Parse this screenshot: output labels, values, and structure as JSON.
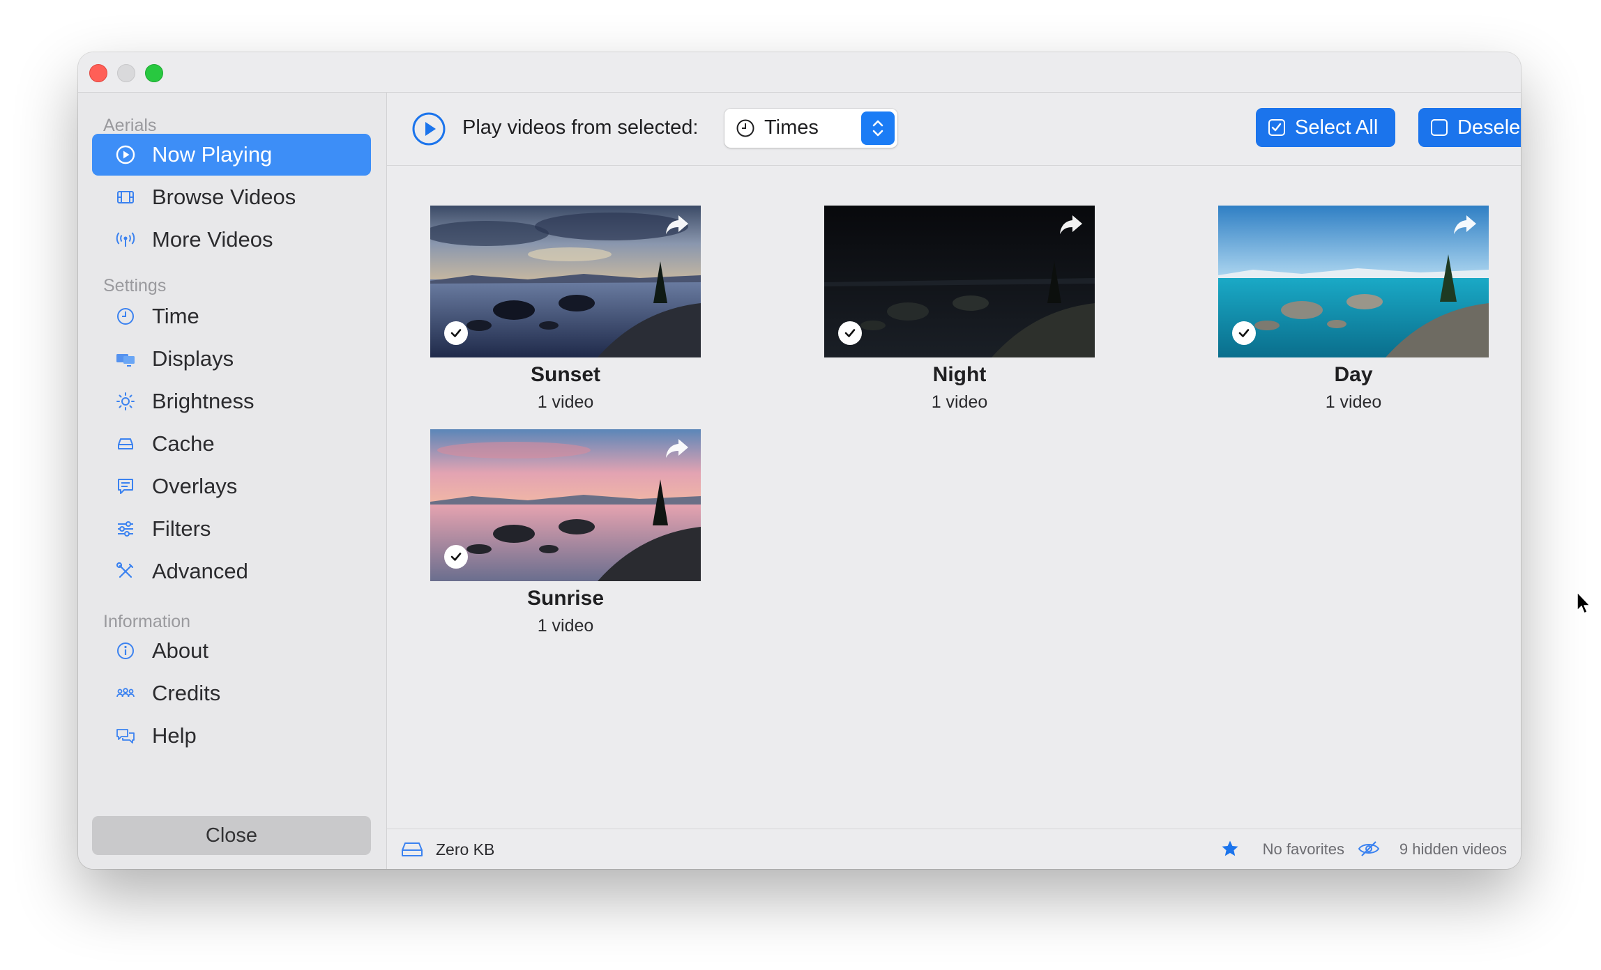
{
  "window": {
    "traffic_lights": [
      "close",
      "minimize",
      "maximize"
    ]
  },
  "sidebar": {
    "sections": [
      {
        "title": "Aerials",
        "items": [
          {
            "label": "Now Playing",
            "icon": "play-circle-icon",
            "active": true
          },
          {
            "label": "Browse Videos",
            "icon": "film-icon"
          },
          {
            "label": "More Videos",
            "icon": "antenna-icon"
          }
        ]
      },
      {
        "title": "Settings",
        "items": [
          {
            "label": "Time",
            "icon": "clock-icon"
          },
          {
            "label": "Displays",
            "icon": "displays-icon"
          },
          {
            "label": "Brightness",
            "icon": "sun-icon"
          },
          {
            "label": "Cache",
            "icon": "drive-icon"
          },
          {
            "label": "Overlays",
            "icon": "speech-bubble-icon"
          },
          {
            "label": "Filters",
            "icon": "sliders-icon"
          },
          {
            "label": "Advanced",
            "icon": "tools-icon"
          }
        ]
      },
      {
        "title": "Information",
        "items": [
          {
            "label": "About",
            "icon": "info-icon"
          },
          {
            "label": "Credits",
            "icon": "people-icon"
          },
          {
            "label": "Help",
            "icon": "chat-bubbles-icon"
          }
        ]
      }
    ],
    "close_label": "Close"
  },
  "toolbar": {
    "play_label": "Play videos from selected:",
    "popup_value": "Times",
    "select_all": "Select All",
    "deselect_all": "Deselect All"
  },
  "cards": [
    {
      "title": "Sunset",
      "subtitle": "1 video",
      "checked": true,
      "scene": "sunset"
    },
    {
      "title": "Night",
      "subtitle": "1 video",
      "checked": true,
      "scene": "night"
    },
    {
      "title": "Day",
      "subtitle": "1 video",
      "checked": true,
      "scene": "day"
    },
    {
      "title": "Sunrise",
      "subtitle": "1 video",
      "checked": true,
      "scene": "sunrise"
    }
  ],
  "status": {
    "cache_size": "Zero KB",
    "favorites": "No favorites",
    "hidden": "9 hidden videos"
  },
  "colors": {
    "accent": "#1b74ec",
    "sidebar_active": "#3d8ef7",
    "icon_blue": "#3b82f0"
  }
}
